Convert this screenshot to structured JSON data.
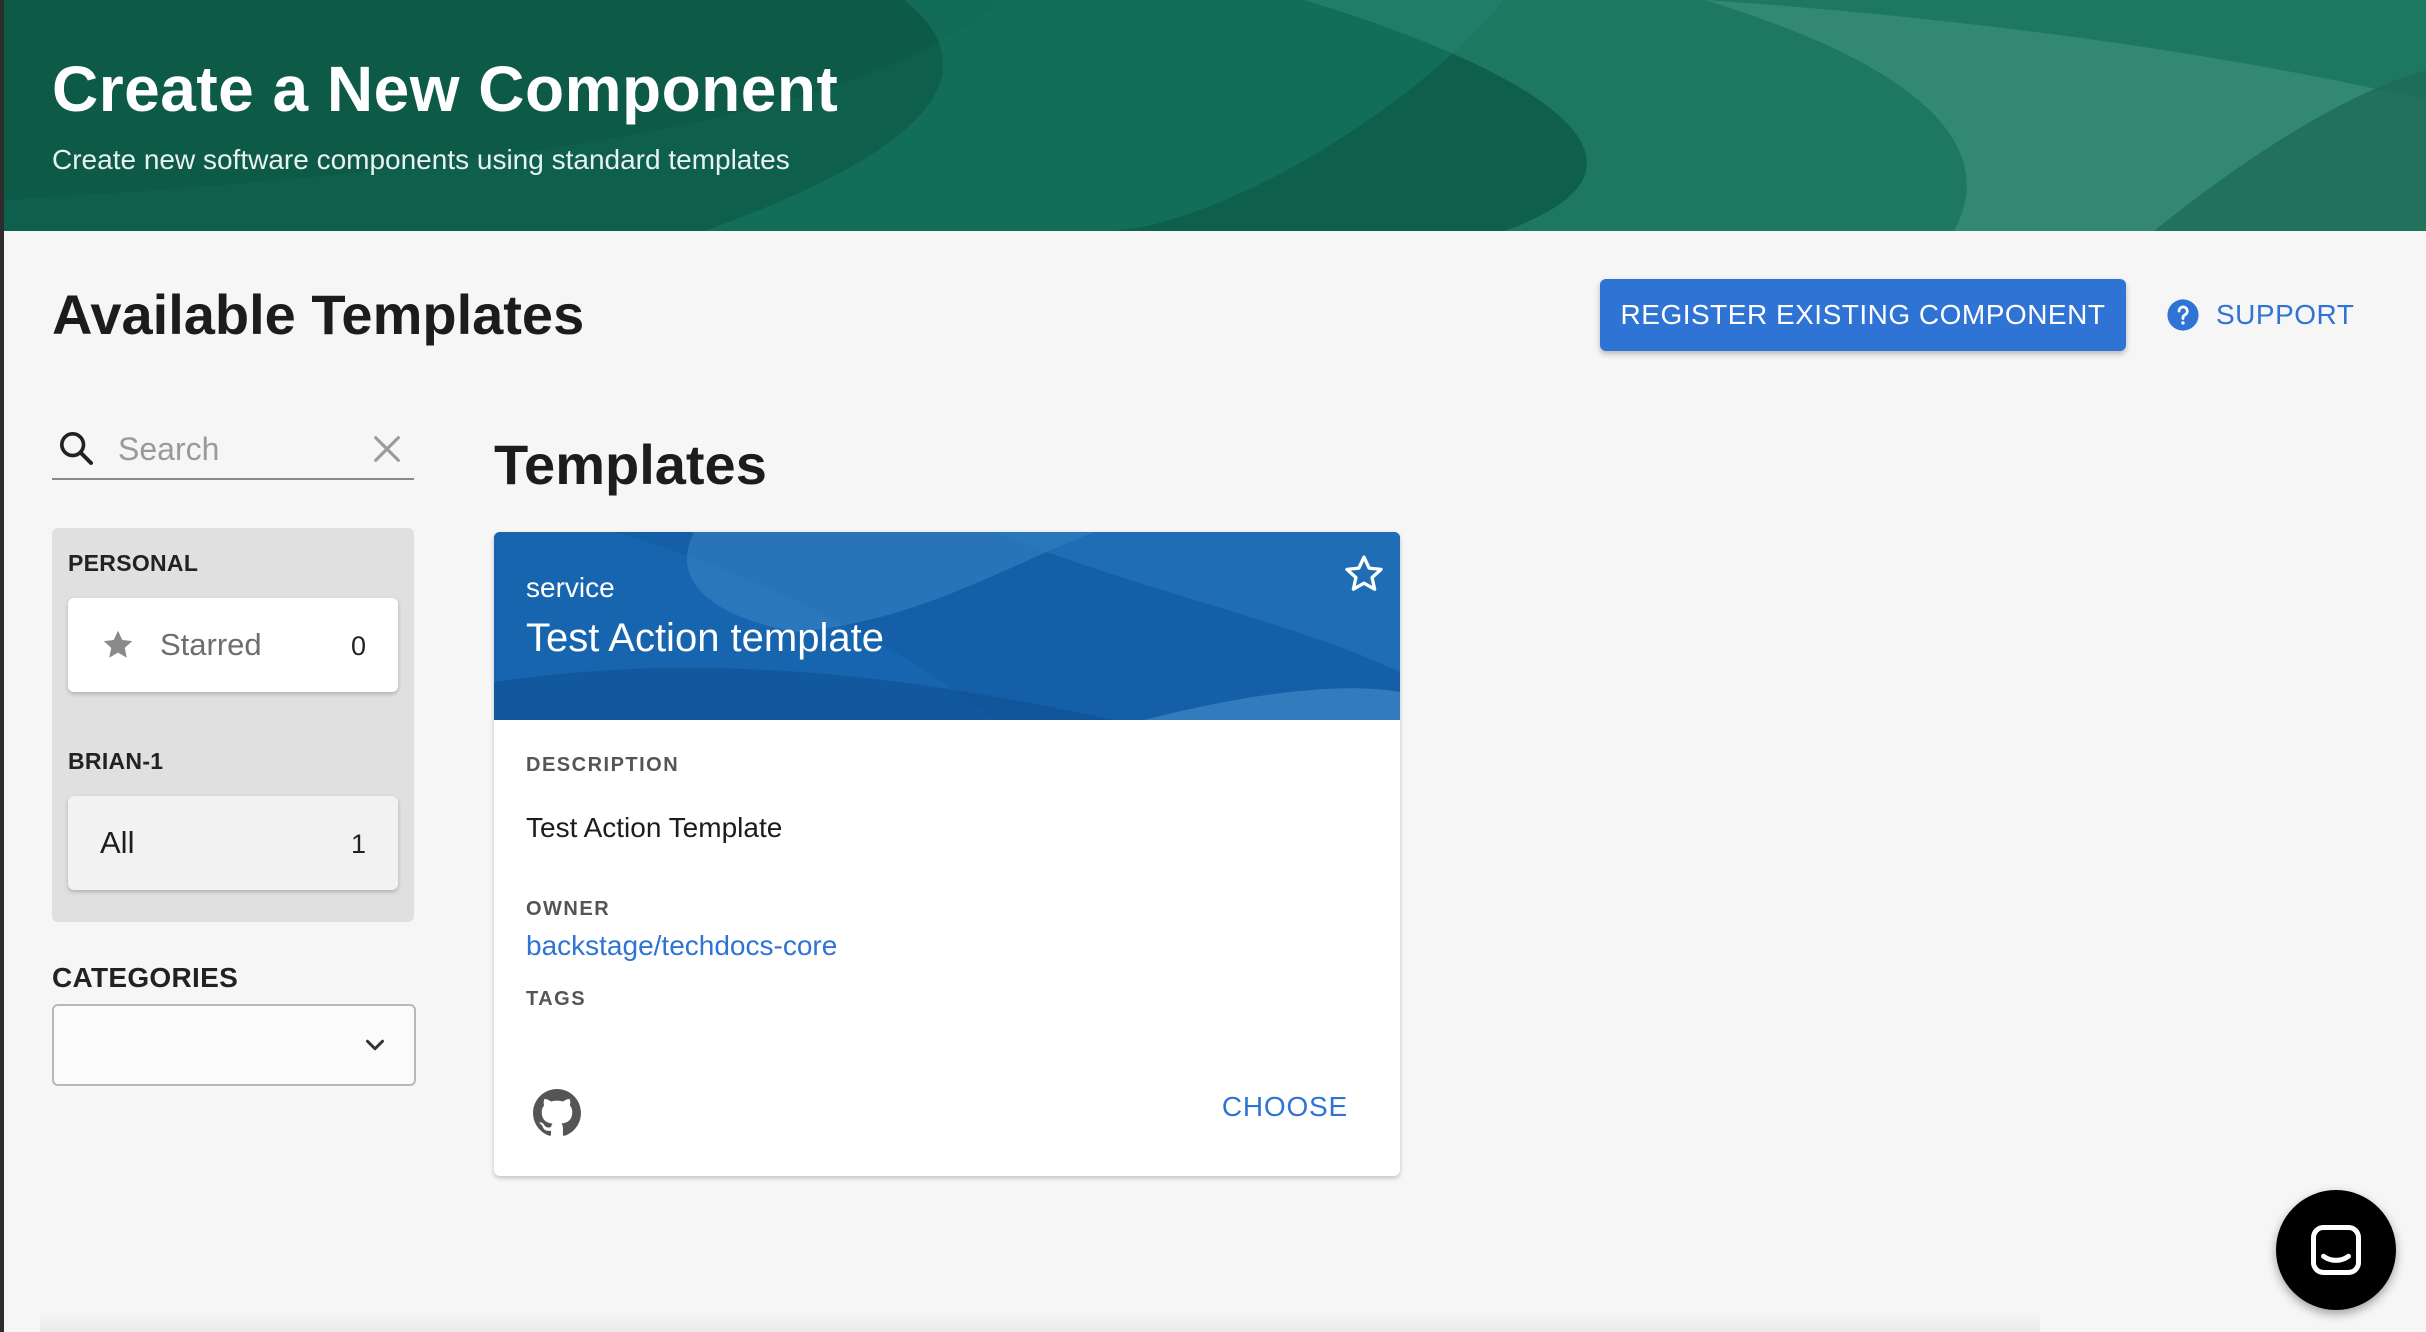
{
  "header": {
    "title": "Create a New Component",
    "subtitle": "Create new software components using standard templates",
    "colors": {
      "background": "#0f5f4d"
    }
  },
  "page": {
    "title": "Available Templates"
  },
  "actions": {
    "register_label": "REGISTER EXISTING COMPONENT",
    "support_label": "SUPPORT",
    "support_icon": "help-circle-icon",
    "colors": {
      "primary": "#2f74d4"
    }
  },
  "sidebar": {
    "search": {
      "placeholder": "Search",
      "value": ""
    },
    "groups": [
      {
        "label": "PERSONAL",
        "items": [
          {
            "label": "Starred",
            "count": "0",
            "icon": "star-icon"
          }
        ]
      },
      {
        "label": "BRIAN-1",
        "items": [
          {
            "label": "All",
            "count": "1",
            "selected": true
          }
        ]
      }
    ],
    "categories": {
      "label": "CATEGORIES",
      "value": ""
    }
  },
  "templates": {
    "section_title": "Templates",
    "cards": [
      {
        "type": "service",
        "title": "Test Action template",
        "description_label": "DESCRIPTION",
        "description": "Test Action Template",
        "owner_label": "OWNER",
        "owner": "backstage/techdocs-core",
        "tags_label": "TAGS",
        "action_label": "CHOOSE",
        "source_icon": "github-icon",
        "colors": {
          "header": "#155fa8"
        }
      }
    ]
  },
  "chat": {
    "icon": "chat-icon"
  }
}
